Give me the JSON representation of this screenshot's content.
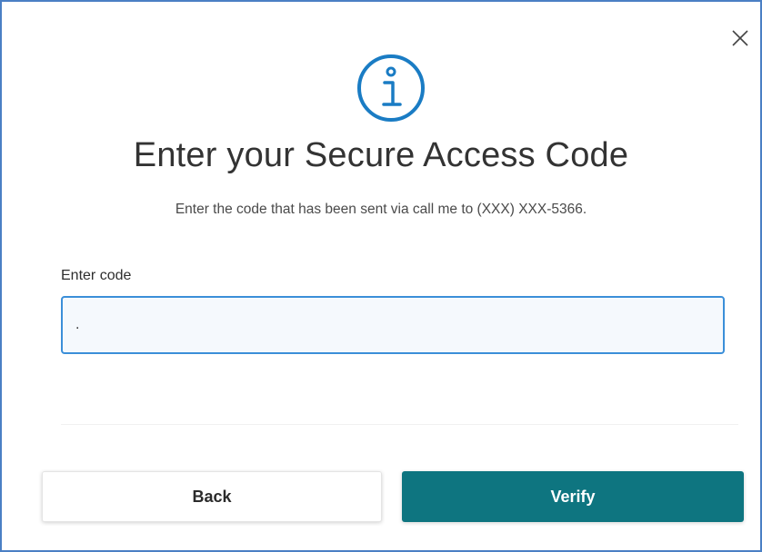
{
  "dialog": {
    "title": "Enter your Secure Access Code",
    "subtitle": "Enter the code that has been sent via call me to (XXX) XXX-5366.",
    "close_icon": "close-icon",
    "info_icon": "info-icon"
  },
  "code_field": {
    "label": "Enter code",
    "value": ".",
    "placeholder": ""
  },
  "buttons": {
    "back_label": "Back",
    "verify_label": "Verify"
  },
  "colors": {
    "accent": "#1a7cc4",
    "verify_bg": "#0e7580",
    "input_border": "#3b8fd9",
    "dialog_border": "#4a7fc4"
  }
}
